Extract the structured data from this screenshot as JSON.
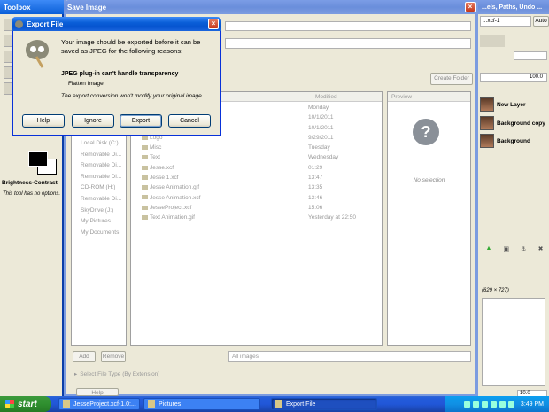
{
  "toolbox": {
    "title": "Toolbox",
    "tool_options_title": "Brightness-Contrast",
    "tool_options_message": "This tool has no options."
  },
  "save_window": {
    "title": "Save Image",
    "create_folder_label": "Create Folder",
    "places": [
      "Local Disk (C:)",
      "Removable Di...",
      "Removable Di...",
      "Removable Di...",
      "CD-ROM (H:)",
      "Removable Di...",
      "SkyDrive (J:)",
      "My Pictures",
      "My Documents"
    ],
    "columns": {
      "modified": "Modified",
      "preview": "Preview"
    },
    "files": [
      {
        "name": "",
        "modified": "Monday"
      },
      {
        "name": "",
        "modified": "10/1/2011"
      },
      {
        "name": "",
        "modified": "10/1/2011"
      },
      {
        "name": "Logo",
        "modified": "9/29/2011"
      },
      {
        "name": "Misc",
        "modified": "Tuesday"
      },
      {
        "name": "Text",
        "modified": "Wednesday"
      },
      {
        "name": "Jesse.xcf",
        "modified": "01:29"
      },
      {
        "name": "Jesse 1.xcf",
        "modified": "13:47"
      },
      {
        "name": "Jesse Animation.gif",
        "modified": "13:35"
      },
      {
        "name": "Jesse Animation.xcf",
        "modified": "13:46"
      },
      {
        "name": "JesseProject.xcf",
        "modified": "15:06"
      },
      {
        "name": "Text Animation.gif",
        "modified": "Yesterday at 22:50"
      }
    ],
    "preview_text": "No selection",
    "add_label": "Add",
    "remove_label": "Remove",
    "filter_value": "All images",
    "file_type_label": "Select File Type (By Extension)",
    "help_label": "Help"
  },
  "dock": {
    "title": "...els, Paths, Undo ...",
    "image_select": "...xcf-1",
    "auto_label": "Auto",
    "opacity": "100.0",
    "layers": [
      "New Layer",
      "Background copy",
      "Background"
    ],
    "brush_info": "(629 × 727)",
    "spacing": "10.0"
  },
  "export_dialog": {
    "title": "Export File",
    "message": "Your image should be exported before it can be saved as JPEG for the following reasons:",
    "reason": "JPEG plug-in can't handle transparency",
    "option": "Flatten Image",
    "note": "The export conversion won't modify your original image.",
    "buttons": {
      "help": "Help",
      "ignore": "Ignore",
      "export": "Export",
      "cancel": "Cancel"
    }
  },
  "taskbar": {
    "start_label": "start",
    "tasks": [
      "JesseProject.xcf-1.0:...",
      "Pictures",
      "Export File"
    ],
    "clock": "3:49 PM"
  }
}
